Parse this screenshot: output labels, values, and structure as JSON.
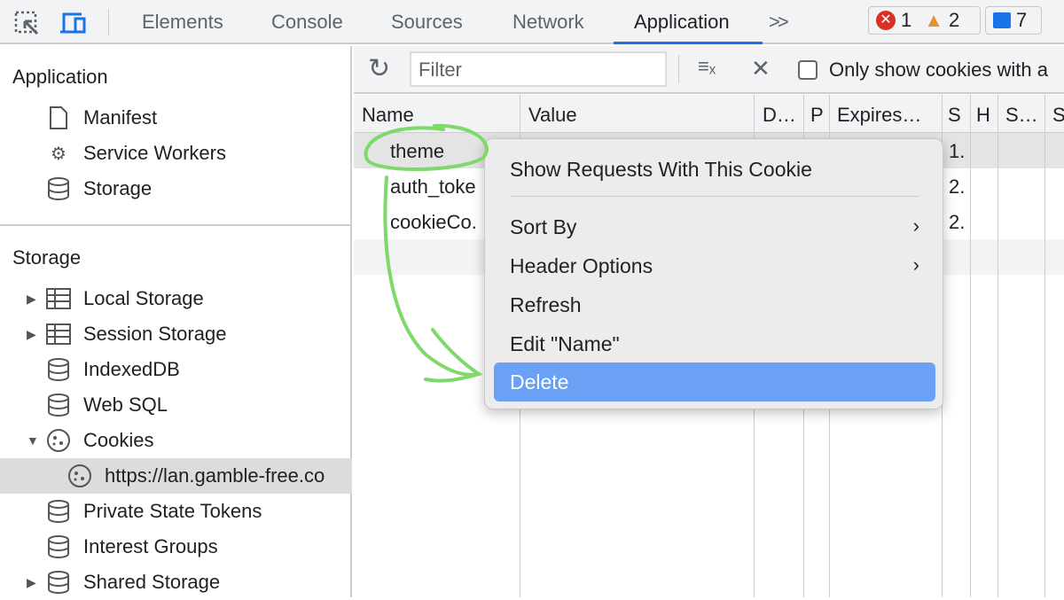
{
  "topbar": {
    "tabs": [
      "Elements",
      "Console",
      "Sources",
      "Network",
      "Application"
    ],
    "active_tab": "Application",
    "more": ">>",
    "errors": "1",
    "warnings": "2",
    "messages": "7"
  },
  "sidebar": {
    "application_title": "Application",
    "app_items": [
      "Manifest",
      "Service Workers",
      "Storage"
    ],
    "storage_title": "Storage",
    "storage_items": [
      "Local Storage",
      "Session Storage",
      "IndexedDB",
      "Web SQL",
      "Cookies",
      "https://lan.gamble-free.co",
      "Private State Tokens",
      "Interest Groups",
      "Shared Storage"
    ]
  },
  "toolbar": {
    "filter_placeholder": "Filter",
    "only_show_label": "Only show cookies with a"
  },
  "table": {
    "columns": [
      "Name",
      "Value",
      "D…",
      "P",
      "Expires…",
      "S",
      "H",
      "S…",
      "S"
    ],
    "rows": [
      {
        "name": "theme",
        "s": "1."
      },
      {
        "name": "auth_toke",
        "s": "2."
      },
      {
        "name": "cookieCo.",
        "s": "2."
      }
    ]
  },
  "context_menu": {
    "items": [
      "Show Requests With This Cookie",
      "Sort By",
      "Header Options",
      "Refresh",
      "Edit \"Name\"",
      "Delete"
    ],
    "highlighted": "Delete"
  },
  "colors": {
    "accent": "#1a73e8",
    "highlight": "#6aa1f5",
    "annotation": "#7ed96a"
  }
}
